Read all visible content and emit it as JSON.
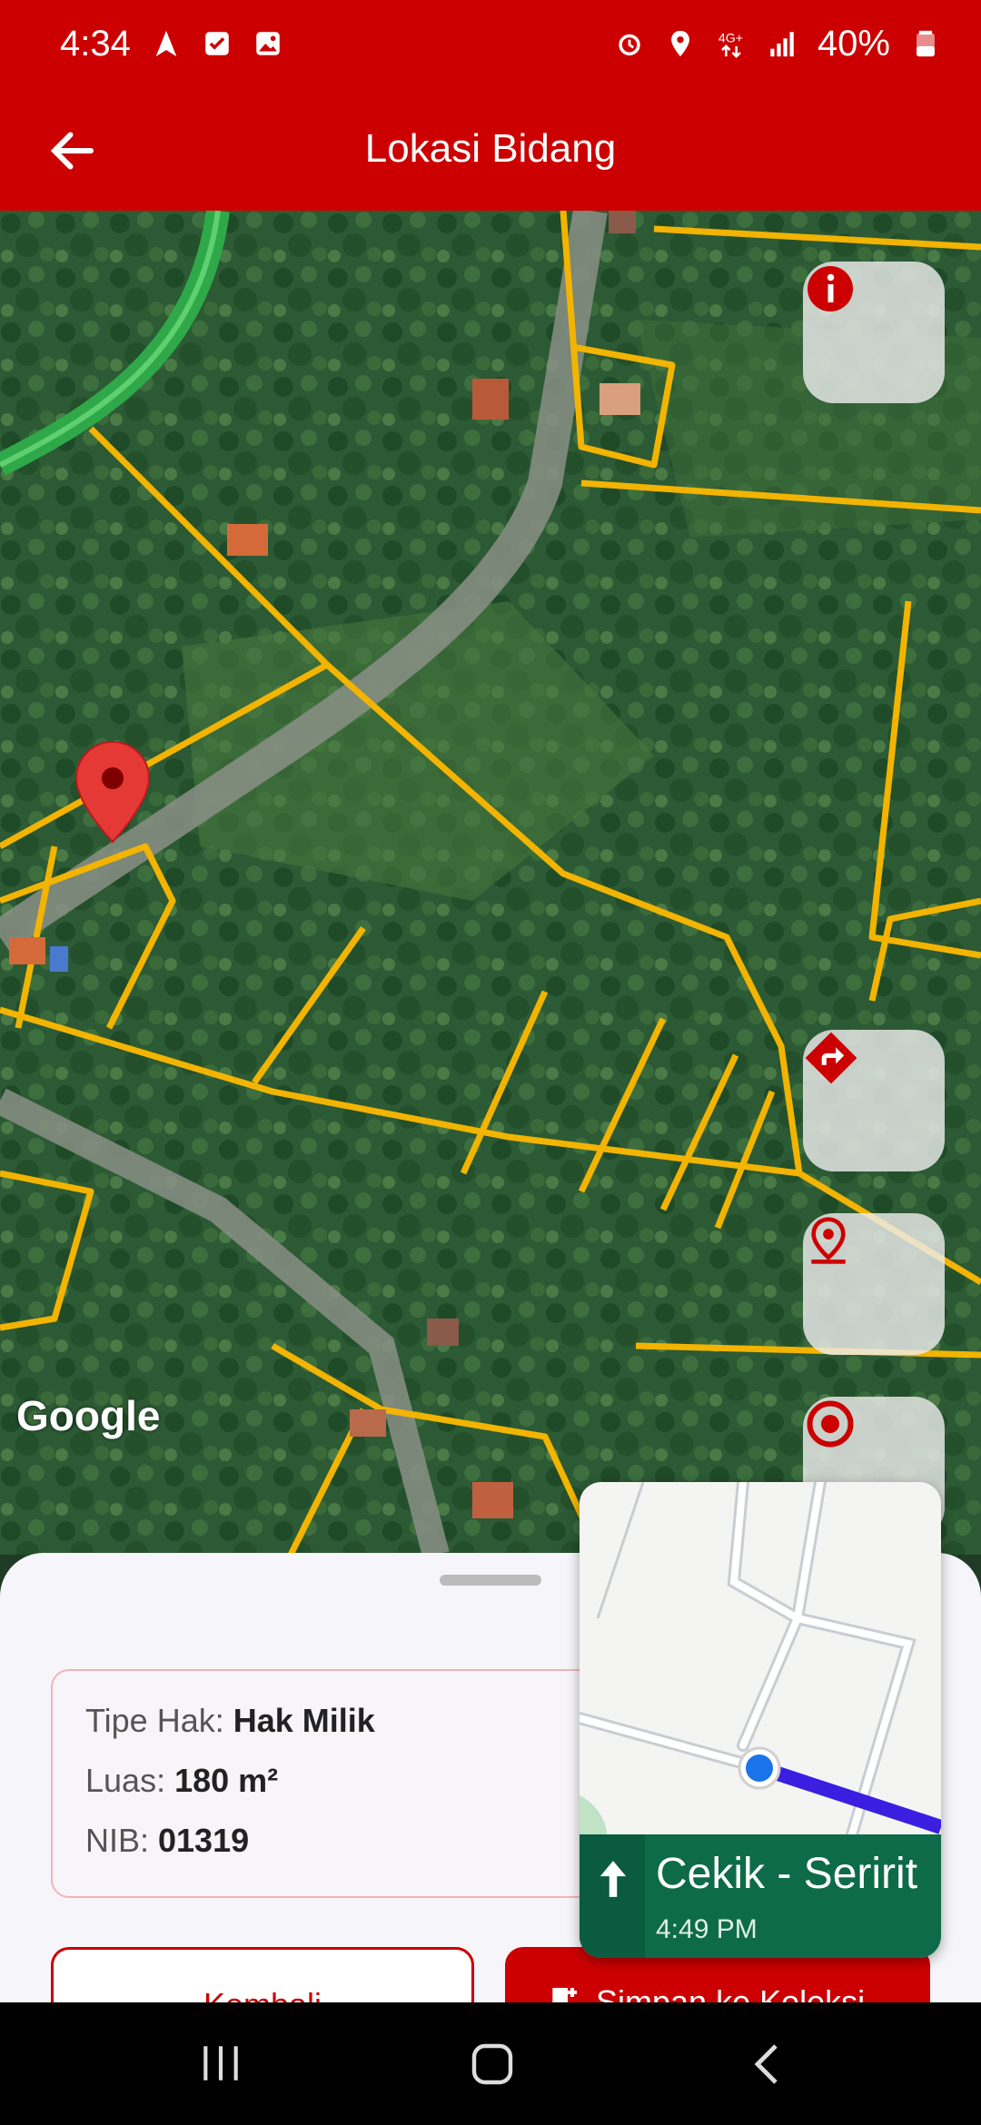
{
  "status_bar": {
    "time": "4:34",
    "battery_text": "40%",
    "left_icons": [
      "navigation-arrow-icon",
      "check-box-icon",
      "image-icon"
    ],
    "right_icons": [
      "alarm-icon",
      "location-icon",
      "data-4g-icon",
      "signal-icon",
      "battery-icon"
    ]
  },
  "app_bar": {
    "title": "Lokasi Bidang",
    "back_icon": "arrow-left-icon"
  },
  "map": {
    "provider_logo": "Google",
    "buttons": [
      {
        "name": "info-button",
        "icon": "info-icon"
      },
      {
        "name": "directions-button",
        "icon": "directions-icon"
      },
      {
        "name": "location-pin-button",
        "icon": "map-pin-icon"
      },
      {
        "name": "my-location-button",
        "icon": "target-icon"
      }
    ],
    "accent_color": "#cc0000"
  },
  "sheet": {
    "info": {
      "tipe_hak_label": "Tipe Hak: ",
      "tipe_hak_value": "Hak Milik",
      "luas_label": "Luas: ",
      "luas_value": "180 m²",
      "nib_label": "NIB: ",
      "nib_value": "01319"
    },
    "back_button": "Kembali",
    "save_button": "Simpan ke Koleksi"
  },
  "navigation_overlay": {
    "street": "Cekik - Seririt",
    "time": "4:49 PM",
    "banner_color": "#0d6b4a"
  },
  "system_nav": {
    "recent_icon": "recent-apps-icon",
    "home_icon": "home-icon",
    "back_icon": "back-icon"
  }
}
